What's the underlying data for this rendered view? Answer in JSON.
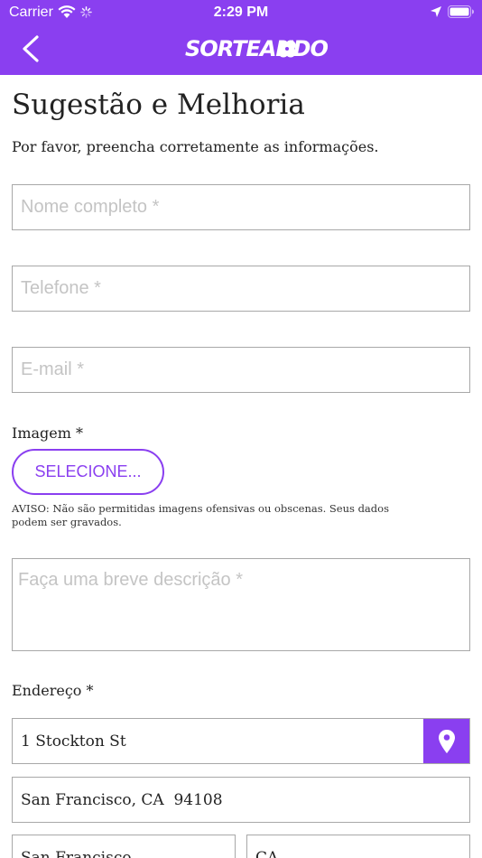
{
  "status_bar": {
    "carrier": "Carrier",
    "time": "2:29 PM"
  },
  "header": {
    "logo_text": "SORTEANDO",
    "back_icon": "chevron-left-icon",
    "accent_color": "#8a3ff0"
  },
  "page": {
    "title": "Sugestão e Melhoria",
    "subtitle": "Por favor, preencha corretamente as informações."
  },
  "form": {
    "name_placeholder": "Nome completo *",
    "phone_placeholder": "Telefone *",
    "email_placeholder": "E-mail *",
    "image_label": "Imagem *",
    "select_button": "SELECIONE...",
    "warning": "AVISO: Não são permitidas imagens ofensivas ou obscenas. Seus dados podem ser gravados.",
    "description_placeholder": "Faça uma breve descrição *",
    "address_label": "Endereço *",
    "street_value": "1 Stockton St",
    "city_zip_value": "San Francisco, CA  94108",
    "city_value": "San Francisco",
    "state_value": "CA"
  }
}
